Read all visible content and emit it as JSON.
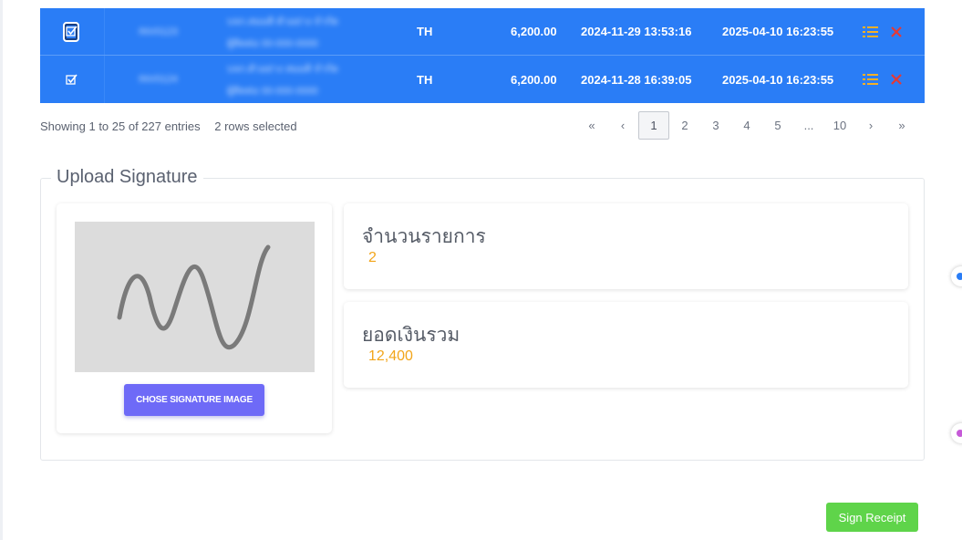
{
  "rows": [
    {
      "checked": true,
      "focused": true,
      "id": "INV0123",
      "name1": "บจก.สมมติ ตัวอย่าง จำกัด",
      "name2": "ผู้ติดต่อ 00-000-0000",
      "lang": "TH",
      "amount": "6,200.00",
      "created": "2024-11-29 13:53:16",
      "updated": "2025-04-10 16:23:55"
    },
    {
      "checked": true,
      "focused": false,
      "id": "INV0124",
      "name1": "บจก.ตัวอย่าง สมมติ จำกัด",
      "name2": "ผู้ติดต่อ 00-000-0000",
      "lang": "TH",
      "amount": "6,200.00",
      "created": "2024-11-28 16:39:05",
      "updated": "2025-04-10 16:23:55"
    }
  ],
  "icons": {
    "checkbox": "checkbox-checked-icon",
    "list": "list-icon",
    "delete": "close-icon"
  },
  "colors": {
    "row_selected": "#2a7df6",
    "list_icon": "#f5b027",
    "delete_icon": "#e53935",
    "accent_value": "#f2a51a",
    "upload_button": "#6e6af7",
    "sign_button": "#5fd44a"
  },
  "info": {
    "entries": "Showing 1 to 25 of 227 entries",
    "selected": "2 rows selected"
  },
  "pagination": {
    "first": "«",
    "prev": "‹",
    "pages": [
      "1",
      "2",
      "3",
      "4",
      "5",
      "...",
      "10"
    ],
    "active": "1",
    "next": "›",
    "last": "»"
  },
  "upload": {
    "title": "Upload Signature",
    "button": "CHOSE SIGNATURE IMAGE",
    "count_label": "จำนวนรายการ",
    "count_value": "2",
    "total_label": "ยอดเงินรวม",
    "total_value": "12,400"
  },
  "sign_button": "Sign Receipt"
}
